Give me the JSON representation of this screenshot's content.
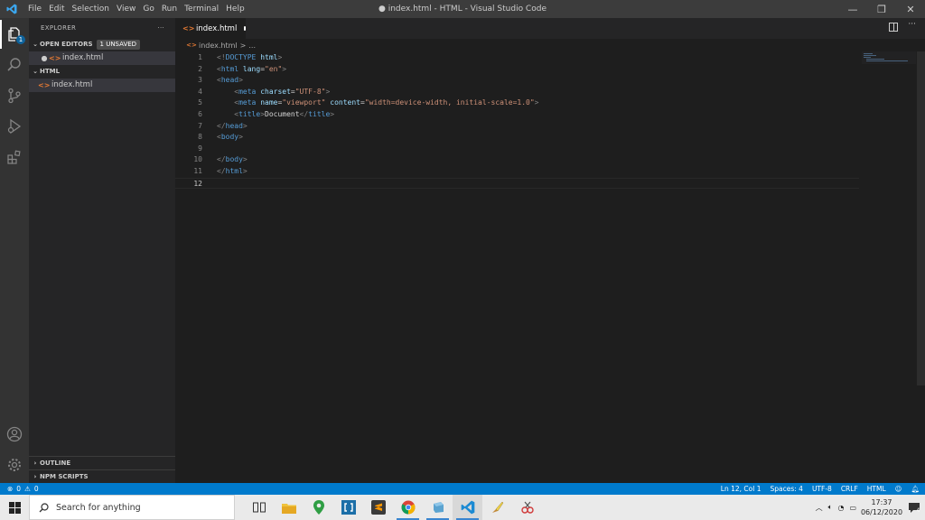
{
  "window": {
    "title": "● index.html - HTML - Visual Studio Code",
    "menu": [
      "File",
      "Edit",
      "Selection",
      "View",
      "Go",
      "Run",
      "Terminal",
      "Help"
    ],
    "controls": {
      "minimize": "—",
      "maximize": "❐",
      "close": "✕"
    }
  },
  "activity": {
    "explorer_badge": "1"
  },
  "sidebar": {
    "title": "EXPLORER",
    "more": "···",
    "open_editors_label": "OPEN EDITORS",
    "unsaved_badge": "1 UNSAVED",
    "open_editors": [
      {
        "dirty": "●",
        "icon": "<>",
        "name": "index.html"
      }
    ],
    "folder_label": "HTML",
    "files": [
      {
        "icon": "<>",
        "name": "index.html"
      }
    ],
    "outline_label": "OUTLINE",
    "npm_label": "NPM SCRIPTS"
  },
  "editor": {
    "tab": {
      "icon": "<>",
      "name": "index.html"
    },
    "breadcrumb": {
      "icon": "<>",
      "file": "index.html",
      "sep": ">",
      "rest": "..."
    },
    "lines": [
      {
        "n": "1",
        "tokens": [
          {
            "c": "t-br",
            "t": "<!"
          },
          {
            "c": "t-tag",
            "t": "DOCTYPE"
          },
          {
            "c": "t-text",
            "t": " "
          },
          {
            "c": "t-attr",
            "t": "html"
          },
          {
            "c": "t-br",
            "t": ">"
          }
        ]
      },
      {
        "n": "2",
        "tokens": [
          {
            "c": "t-br",
            "t": "<"
          },
          {
            "c": "t-tag",
            "t": "html"
          },
          {
            "c": "t-text",
            "t": " "
          },
          {
            "c": "t-attr",
            "t": "lang"
          },
          {
            "c": "t-text",
            "t": "="
          },
          {
            "c": "t-str",
            "t": "\"en\""
          },
          {
            "c": "t-br",
            "t": ">"
          }
        ]
      },
      {
        "n": "3",
        "tokens": [
          {
            "c": "t-br",
            "t": "<"
          },
          {
            "c": "t-tag",
            "t": "head"
          },
          {
            "c": "t-br",
            "t": ">"
          }
        ]
      },
      {
        "n": "4",
        "tokens": [
          {
            "c": "t-text",
            "t": "    "
          },
          {
            "c": "t-br",
            "t": "<"
          },
          {
            "c": "t-tag",
            "t": "meta"
          },
          {
            "c": "t-text",
            "t": " "
          },
          {
            "c": "t-attr",
            "t": "charset"
          },
          {
            "c": "t-text",
            "t": "="
          },
          {
            "c": "t-str",
            "t": "\"UTF-8\""
          },
          {
            "c": "t-br",
            "t": ">"
          }
        ]
      },
      {
        "n": "5",
        "tokens": [
          {
            "c": "t-text",
            "t": "    "
          },
          {
            "c": "t-br",
            "t": "<"
          },
          {
            "c": "t-tag",
            "t": "meta"
          },
          {
            "c": "t-text",
            "t": " "
          },
          {
            "c": "t-attr",
            "t": "name"
          },
          {
            "c": "t-text",
            "t": "="
          },
          {
            "c": "t-str",
            "t": "\"viewport\""
          },
          {
            "c": "t-text",
            "t": " "
          },
          {
            "c": "t-attr",
            "t": "content"
          },
          {
            "c": "t-text",
            "t": "="
          },
          {
            "c": "t-str",
            "t": "\"width=device-width, initial-scale=1.0\""
          },
          {
            "c": "t-br",
            "t": ">"
          }
        ]
      },
      {
        "n": "6",
        "tokens": [
          {
            "c": "t-text",
            "t": "    "
          },
          {
            "c": "t-br",
            "t": "<"
          },
          {
            "c": "t-tag",
            "t": "title"
          },
          {
            "c": "t-br",
            "t": ">"
          },
          {
            "c": "t-text",
            "t": "Document"
          },
          {
            "c": "t-br",
            "t": "</"
          },
          {
            "c": "t-tag",
            "t": "title"
          },
          {
            "c": "t-br",
            "t": ">"
          }
        ]
      },
      {
        "n": "7",
        "tokens": [
          {
            "c": "t-br",
            "t": "</"
          },
          {
            "c": "t-tag",
            "t": "head"
          },
          {
            "c": "t-br",
            "t": ">"
          }
        ]
      },
      {
        "n": "8",
        "tokens": [
          {
            "c": "t-br",
            "t": "<"
          },
          {
            "c": "t-tag",
            "t": "body"
          },
          {
            "c": "t-br",
            "t": ">"
          }
        ]
      },
      {
        "n": "9",
        "tokens": []
      },
      {
        "n": "10",
        "tokens": [
          {
            "c": "t-br",
            "t": "</"
          },
          {
            "c": "t-tag",
            "t": "body"
          },
          {
            "c": "t-br",
            "t": ">"
          }
        ]
      },
      {
        "n": "11",
        "tokens": [
          {
            "c": "t-br",
            "t": "</"
          },
          {
            "c": "t-tag",
            "t": "html"
          },
          {
            "c": "t-br",
            "t": ">"
          }
        ]
      },
      {
        "n": "12",
        "tokens": []
      }
    ]
  },
  "status": {
    "errors": "0",
    "warnings": "0",
    "position": "Ln 12, Col 1",
    "spaces": "Spaces: 4",
    "encoding": "UTF-8",
    "eol": "CRLF",
    "language": "HTML"
  },
  "taskbar": {
    "search_placeholder": "Search for anything",
    "time": "17:37",
    "date": "06/12/2020",
    "notifications": "4"
  },
  "colors": {
    "accent": "#007acc",
    "html_icon": "#e37933"
  }
}
